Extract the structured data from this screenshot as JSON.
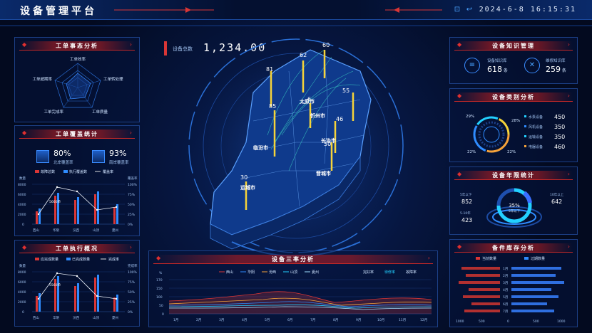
{
  "header": {
    "title": "设备管理平台",
    "datetime": "2024-6-8  16:15:31"
  },
  "left": {
    "panel1": {
      "title": "工单事态分析",
      "radar": [
        "工单效率",
        "工单转处理",
        "工单质量",
        "工单完成率",
        "工单超期率"
      ]
    },
    "panel2": {
      "title": "工单覆盖统计",
      "kpi1": {
        "value": "80%",
        "label": "北岸覆盖率"
      },
      "kpi2": {
        "value": "93%",
        "label": "南岸覆盖率"
      },
      "legend": [
        "故障总数",
        "执行覆盖数",
        "覆盖率"
      ],
      "ylabel_left": "数量",
      "ylabel_right": "覆盖率",
      "annot": "5660单",
      "yticks": [
        "8000",
        "6000",
        "4000",
        "2000",
        "0"
      ],
      "yticks_r": [
        "100%",
        "75%",
        "50%",
        "25%",
        "0%"
      ],
      "categories": [
        "西山",
        "华阴",
        "汾西",
        "山顶",
        "夏州"
      ]
    },
    "panel3": {
      "title": "工单执行概况",
      "legend": [
        "应完成数量",
        "已完成数量",
        "完成率"
      ],
      "ylabel_left": "数量",
      "ylabel_right": "完成率",
      "annot": "5560单",
      "yticks": [
        "8000",
        "6000",
        "4000",
        "2000",
        "0"
      ],
      "yticks_r": [
        "100%",
        "75%",
        "50%",
        "25%",
        "0%"
      ],
      "categories": [
        "西山",
        "华阴",
        "汾西",
        "山顶",
        "夏州"
      ]
    }
  },
  "center": {
    "total_label": "设备总数",
    "total_value": "1,234.00",
    "map_values": [
      "60",
      "62",
      "81",
      "55",
      "85",
      "6",
      "46",
      "50",
      "30"
    ],
    "cities": [
      "临汾市",
      "运城市",
      "晋城市",
      "长治市",
      "太原市",
      "忻州市"
    ]
  },
  "bottom": {
    "title": "设备三率分析",
    "legend": [
      "西山",
      "华阴",
      "汾西",
      "山顶",
      "夏州"
    ],
    "extra": [
      "完好率",
      "待修率",
      "故障率"
    ],
    "yticks": [
      "170",
      "150",
      "100",
      "50",
      "0"
    ],
    "ylabel": "%",
    "months": [
      "1月",
      "2月",
      "3月",
      "4月",
      "5月",
      "6月",
      "7月",
      "8月",
      "9月",
      "10月",
      "11月",
      "12月"
    ]
  },
  "right": {
    "panel1": {
      "title": "设备知识管理",
      "items": [
        {
          "label": "设备知识库",
          "value": "618",
          "unit": "条"
        },
        {
          "label": "维修知识库",
          "value": "259",
          "unit": "条"
        }
      ]
    },
    "panel2": {
      "title": "设备类别分析",
      "pcts": [
        "29%",
        "28%",
        "22%",
        "22%"
      ],
      "rows": [
        {
          "label": "水泵设备",
          "value": "450"
        },
        {
          "label": "风机设备",
          "value": "350"
        },
        {
          "label": "运输设备",
          "value": "350"
        },
        {
          "label": "电器设备",
          "value": "460"
        }
      ]
    },
    "panel3": {
      "title": "设备年限统计",
      "center_pct": "35%",
      "center_label": "5年以下",
      "left": [
        {
          "label": "5年以下",
          "value": "852"
        },
        {
          "label": "5-10年",
          "value": "423"
        }
      ],
      "right": [
        {
          "label": "10年以上",
          "value": "642"
        }
      ]
    },
    "panel4": {
      "title": "备件库存分析",
      "legend": [
        "当前数量",
        "过期数量"
      ],
      "months": [
        "1月",
        "2月",
        "3月",
        "4月",
        "5月",
        "6月",
        "7月"
      ],
      "xticks": [
        "1000",
        "500",
        "0",
        "500",
        "1000"
      ]
    }
  },
  "colors": {
    "accent": "#2f8cff",
    "red": "#d93636",
    "yellow": "#f5d33a",
    "cyan": "#23d0ff"
  }
}
